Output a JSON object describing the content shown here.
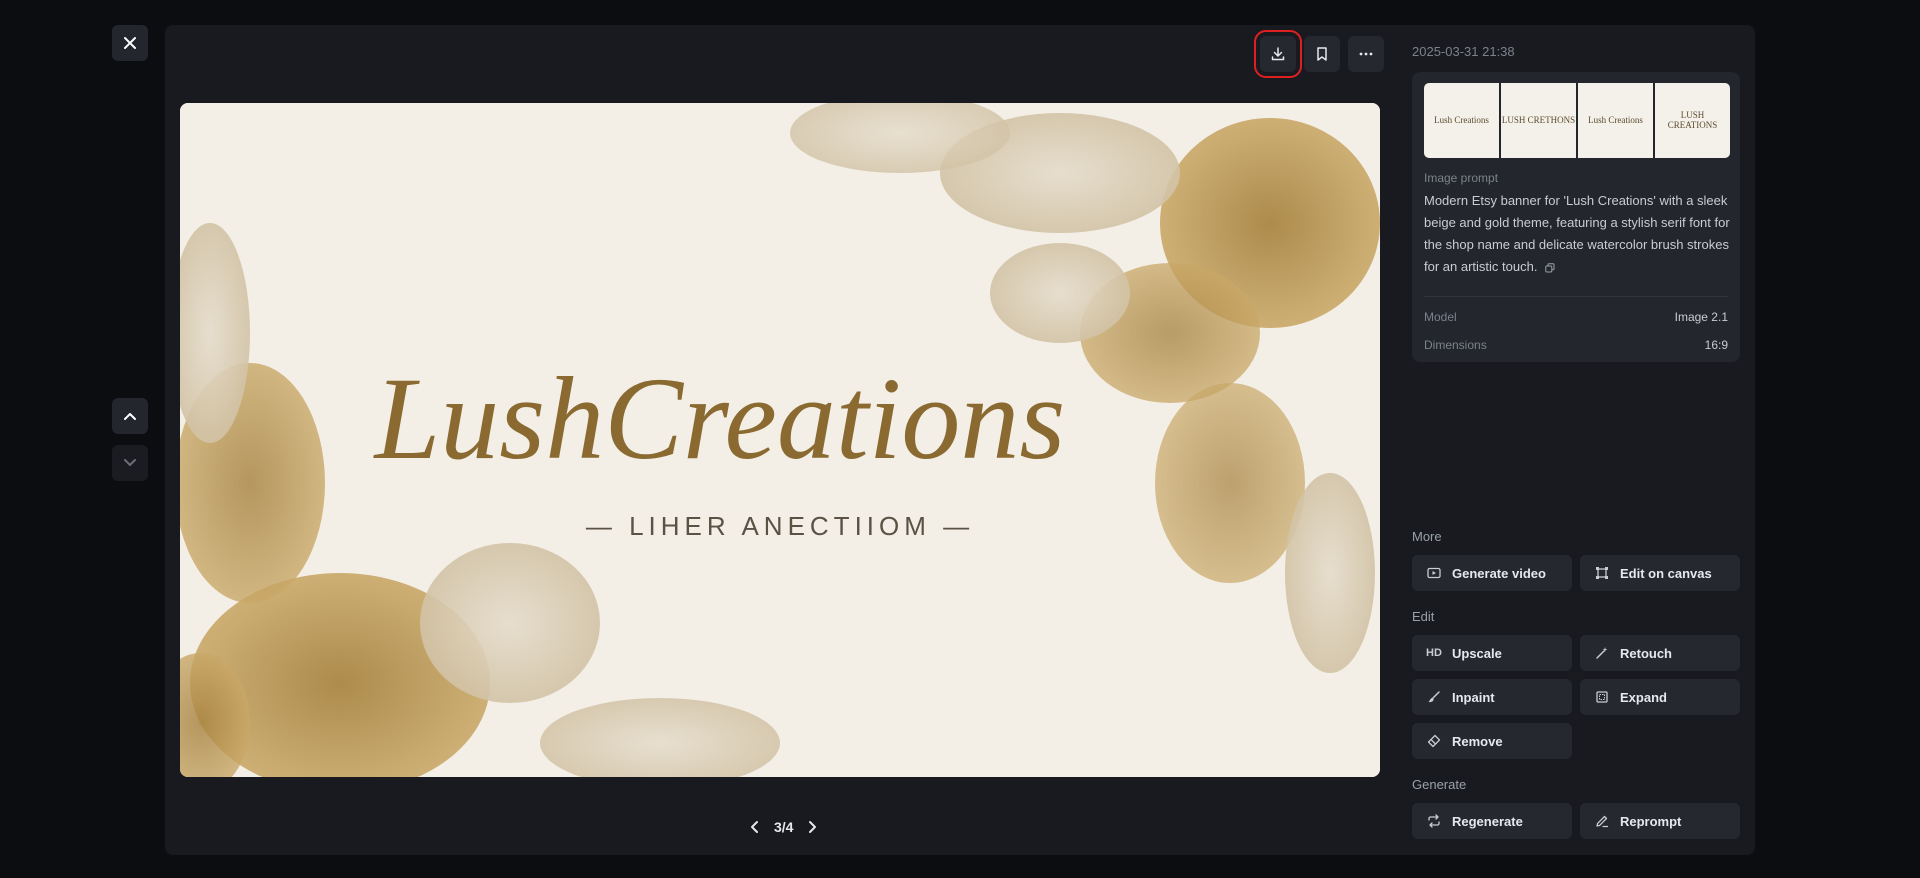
{
  "pager": {
    "text": "3/4"
  },
  "side": {
    "timestamp": "2025-03-31 21:38",
    "thumbnails": [
      "Lush Creations",
      "LUSH CRETHONS",
      "Lush Creations",
      "LUSH CREATIONS"
    ],
    "prompt_label": "Image prompt",
    "prompt_text": "Modern Etsy banner for 'Lush Creations' with a sleek beige and gold theme, featuring a stylish serif font for the shop name and delicate watercolor brush strokes for an artistic touch.",
    "meta": [
      {
        "label": "Model",
        "value": "Image 2.1"
      },
      {
        "label": "Dimensions",
        "value": "16:9"
      }
    ]
  },
  "banner": {
    "title": "LushCreations",
    "subtitle": "— LIHER   ANECTIIOM —"
  },
  "sections": {
    "more": {
      "title": "More",
      "buttons": [
        "Generate video",
        "Edit on canvas"
      ]
    },
    "edit": {
      "title": "Edit",
      "buttons": [
        "Upscale",
        "Retouch",
        "Inpaint",
        "Expand",
        "Remove"
      ]
    },
    "generate": {
      "title": "Generate",
      "buttons": [
        "Regenerate",
        "Reprompt"
      ]
    }
  },
  "icons": {
    "hd": "HD"
  },
  "colors": {
    "highlight": "#e02020",
    "panel": "#181a1f",
    "button": "#25282f"
  }
}
